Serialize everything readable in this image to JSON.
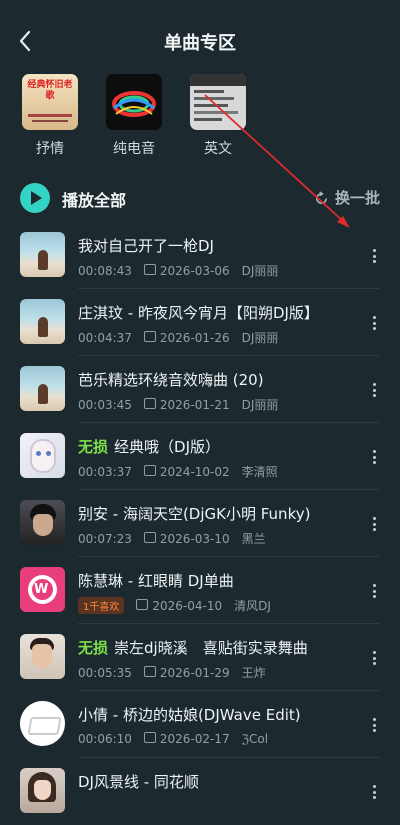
{
  "header": {
    "title": "单曲专区"
  },
  "categories": [
    {
      "label": "抒情",
      "thumb_text": "经典怀旧老歌"
    },
    {
      "label": "纯电音",
      "thumb_text": ""
    },
    {
      "label": "英文",
      "thumb_text": ""
    }
  ],
  "playbar": {
    "play_all": "播放全部",
    "swap": "换一批"
  },
  "songs": [
    {
      "title": "我对自己开了一枪DJ",
      "tag": "",
      "duration": "00:08:43",
      "date": "2026-03-06",
      "artist": "DJ丽丽",
      "cover": "sea"
    },
    {
      "title": "庄淇玟 - 昨夜风今宵月【阳朔DJ版】",
      "tag": "",
      "duration": "00:04:37",
      "date": "2026-01-26",
      "artist": "DJ丽丽",
      "cover": "sea"
    },
    {
      "title": "芭乐精选环绕音效嗨曲 (20)",
      "tag": "",
      "duration": "00:03:45",
      "date": "2026-01-21",
      "artist": "DJ丽丽",
      "cover": "sea"
    },
    {
      "title": "经典哦（DJ版）",
      "tag": "无损",
      "duration": "00:03:37",
      "date": "2024-10-02",
      "artist": "李清照",
      "cover": "anime"
    },
    {
      "title": "别安 - 海阔天空(DjGK小明 Funky)",
      "tag": "",
      "duration": "00:07:23",
      "date": "2026-03-10",
      "artist": "黑兰",
      "cover": "dark"
    },
    {
      "title": "陈慧琳 - 红眼睛 DJ单曲",
      "tag": "",
      "likes": "1千喜欢",
      "duration": "",
      "date": "2026-04-10",
      "artist": "清风DJ",
      "cover": "logo"
    },
    {
      "title": "崇左dj晓溪　喜贴街实录舞曲",
      "tag": "无损",
      "duration": "00:05:35",
      "date": "2026-01-29",
      "artist": "王炸",
      "cover": "boy"
    },
    {
      "title": "小倩 - 桥边的姑娘(DJWave Edit)",
      "tag": "",
      "duration": "00:06:10",
      "date": "2026-02-17",
      "artist": "ℨCol",
      "cover": "dj"
    },
    {
      "title": "DJ风景线 - 同花顺",
      "tag": "",
      "duration": "",
      "date": "",
      "artist": "",
      "cover": "girl"
    }
  ],
  "colors": {
    "bg": "#1c2a2f",
    "accent": "#33d4c6",
    "lossless": "#7ee04a",
    "likes": "#ff8a3d",
    "arrow": "#e02b2b"
  }
}
